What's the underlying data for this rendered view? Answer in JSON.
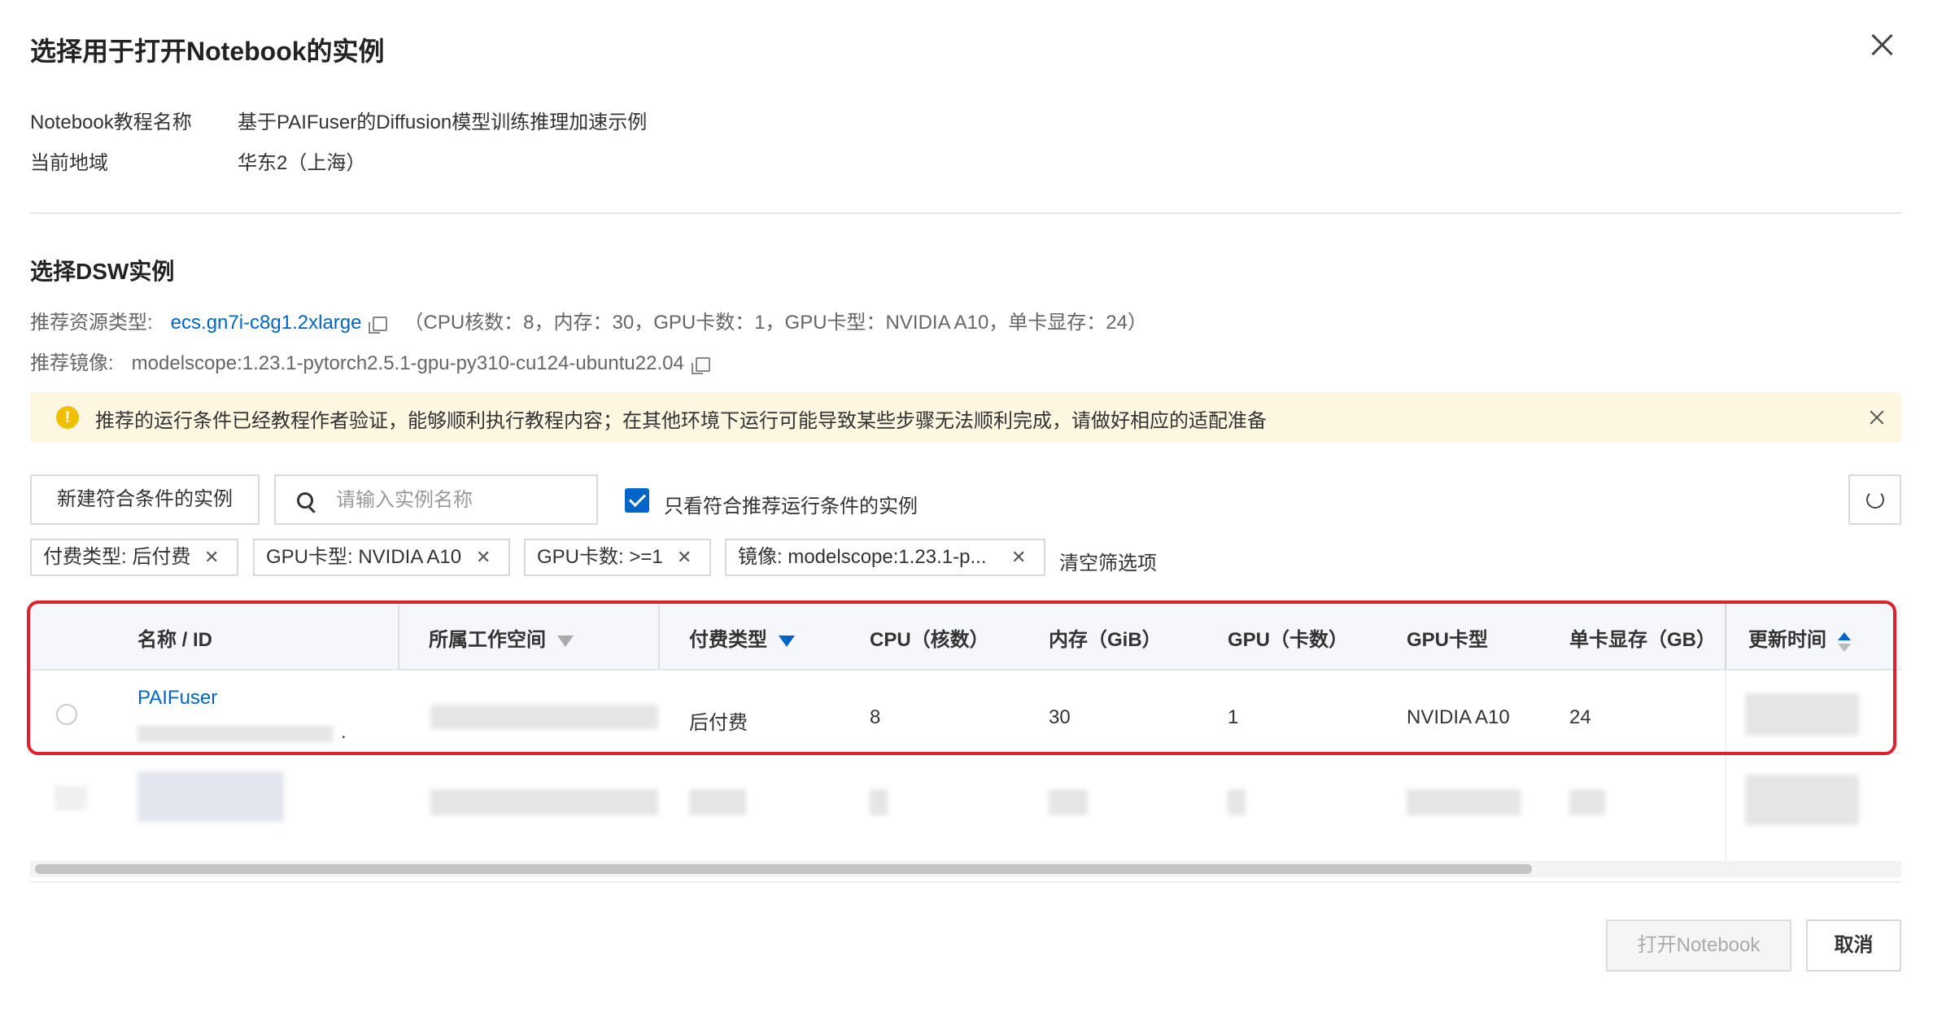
{
  "dialog": {
    "title": "选择用于打开Notebook的实例",
    "close_icon": "close-icon"
  },
  "info": {
    "tutorial_label": "Notebook教程名称",
    "tutorial_value": "基于PAIFuser的Diffusion模型训练推理加速示例",
    "region_label": "当前地域",
    "region_value": "华东2（上海）"
  },
  "section": {
    "title": "选择DSW实例",
    "resource_label": "推荐资源类型:",
    "resource_value": "ecs.gn7i-c8g1.2xlarge",
    "resource_specs": "（CPU核数：8，内存：30，GPU卡数：1，GPU卡型：NVIDIA A10，单卡显存：24）",
    "image_label": "推荐镜像:",
    "image_value": "modelscope:1.23.1-pytorch2.5.1-gpu-py310-cu124-ubuntu22.04"
  },
  "alert": {
    "text": "推荐的运行条件已经教程作者验证，能够顺利执行教程内容；在其他环境下运行可能导致某些步骤无法顺利完成，请做好相应的适配准备"
  },
  "toolbar": {
    "new_button": "新建符合条件的实例",
    "search_placeholder": "请输入实例名称",
    "checkbox_label": "只看符合推荐运行条件的实例",
    "checkbox_checked": true
  },
  "filters": {
    "tags": [
      "付费类型: 后付费",
      "GPU卡型: NVIDIA A10",
      "GPU卡数: >=1",
      "镜像: modelscope:1.23.1-p..."
    ],
    "clear_label": "清空筛选项"
  },
  "table": {
    "columns": [
      "名称 / ID",
      "所属工作空间",
      "付费类型",
      "CPU（核数）",
      "内存（GiB）",
      "GPU（卡数）",
      "GPU卡型",
      "单卡显存（GB）",
      "更新时间"
    ],
    "rows": [
      {
        "name": "PAIFuser",
        "id_suffix": ".",
        "billing": "后付费",
        "cpu": "8",
        "memory": "30",
        "gpu": "1",
        "gpu_type": "NVIDIA A10",
        "gpu_mem": "24"
      }
    ]
  },
  "footer": {
    "open_button": "打开Notebook",
    "cancel_button": "取消"
  },
  "colors": {
    "accent": "#0064c8",
    "alert_bg": "#fdf6e1",
    "highlight_border": "#e0202a"
  }
}
